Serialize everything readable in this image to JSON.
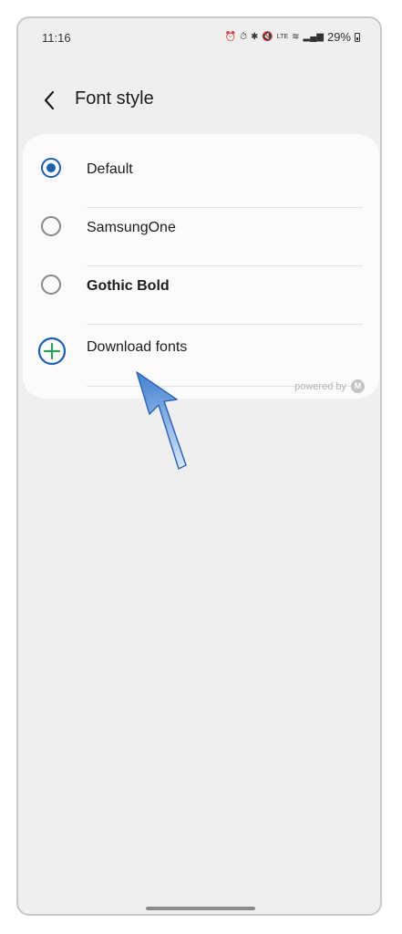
{
  "status_bar": {
    "time": "11:16",
    "icons": [
      "alarm-icon",
      "alarm-clock-icon",
      "bluetooth-icon",
      "mute-icon",
      "volte-icon",
      "wifi-icon",
      "signal-icon",
      "battery-icon"
    ],
    "battery_percent": "29%"
  },
  "header": {
    "back_icon": "chevron-left-icon",
    "title": "Font style"
  },
  "font_options": [
    {
      "label": "Default",
      "selected": true
    },
    {
      "label": "SamsungOne",
      "selected": false
    },
    {
      "label": "Gothic Bold",
      "selected": false
    }
  ],
  "download": {
    "label": "Download fonts",
    "icon": "plus-circle-icon"
  },
  "powered_by": {
    "text": "powered by"
  },
  "colors": {
    "accent": "#1f5fb0",
    "background": "#efefef",
    "card": "#fbfbfb",
    "plus_green": "#2e9e5b"
  }
}
